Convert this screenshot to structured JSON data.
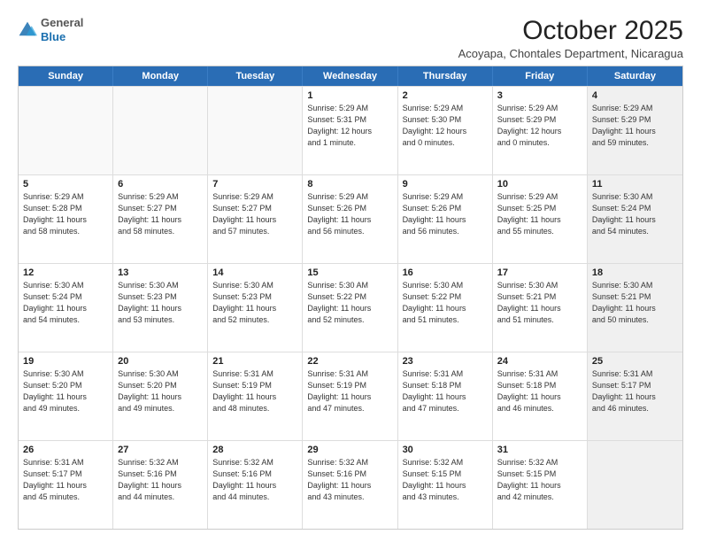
{
  "logo": {
    "general": "General",
    "blue": "Blue"
  },
  "header": {
    "month": "October 2025",
    "location": "Acoyapa, Chontales Department, Nicaragua"
  },
  "weekdays": [
    "Sunday",
    "Monday",
    "Tuesday",
    "Wednesday",
    "Thursday",
    "Friday",
    "Saturday"
  ],
  "weeks": [
    [
      {
        "day": "",
        "info": "",
        "empty": true
      },
      {
        "day": "",
        "info": "",
        "empty": true
      },
      {
        "day": "",
        "info": "",
        "empty": true
      },
      {
        "day": "1",
        "info": "Sunrise: 5:29 AM\nSunset: 5:31 PM\nDaylight: 12 hours\nand 1 minute.",
        "empty": false
      },
      {
        "day": "2",
        "info": "Sunrise: 5:29 AM\nSunset: 5:30 PM\nDaylight: 12 hours\nand 0 minutes.",
        "empty": false
      },
      {
        "day": "3",
        "info": "Sunrise: 5:29 AM\nSunset: 5:29 PM\nDaylight: 12 hours\nand 0 minutes.",
        "empty": false
      },
      {
        "day": "4",
        "info": "Sunrise: 5:29 AM\nSunset: 5:29 PM\nDaylight: 11 hours\nand 59 minutes.",
        "empty": false,
        "shaded": true
      }
    ],
    [
      {
        "day": "5",
        "info": "Sunrise: 5:29 AM\nSunset: 5:28 PM\nDaylight: 11 hours\nand 58 minutes.",
        "empty": false
      },
      {
        "day": "6",
        "info": "Sunrise: 5:29 AM\nSunset: 5:27 PM\nDaylight: 11 hours\nand 58 minutes.",
        "empty": false
      },
      {
        "day": "7",
        "info": "Sunrise: 5:29 AM\nSunset: 5:27 PM\nDaylight: 11 hours\nand 57 minutes.",
        "empty": false
      },
      {
        "day": "8",
        "info": "Sunrise: 5:29 AM\nSunset: 5:26 PM\nDaylight: 11 hours\nand 56 minutes.",
        "empty": false
      },
      {
        "day": "9",
        "info": "Sunrise: 5:29 AM\nSunset: 5:26 PM\nDaylight: 11 hours\nand 56 minutes.",
        "empty": false
      },
      {
        "day": "10",
        "info": "Sunrise: 5:29 AM\nSunset: 5:25 PM\nDaylight: 11 hours\nand 55 minutes.",
        "empty": false
      },
      {
        "day": "11",
        "info": "Sunrise: 5:30 AM\nSunset: 5:24 PM\nDaylight: 11 hours\nand 54 minutes.",
        "empty": false,
        "shaded": true
      }
    ],
    [
      {
        "day": "12",
        "info": "Sunrise: 5:30 AM\nSunset: 5:24 PM\nDaylight: 11 hours\nand 54 minutes.",
        "empty": false
      },
      {
        "day": "13",
        "info": "Sunrise: 5:30 AM\nSunset: 5:23 PM\nDaylight: 11 hours\nand 53 minutes.",
        "empty": false
      },
      {
        "day": "14",
        "info": "Sunrise: 5:30 AM\nSunset: 5:23 PM\nDaylight: 11 hours\nand 52 minutes.",
        "empty": false
      },
      {
        "day": "15",
        "info": "Sunrise: 5:30 AM\nSunset: 5:22 PM\nDaylight: 11 hours\nand 52 minutes.",
        "empty": false
      },
      {
        "day": "16",
        "info": "Sunrise: 5:30 AM\nSunset: 5:22 PM\nDaylight: 11 hours\nand 51 minutes.",
        "empty": false
      },
      {
        "day": "17",
        "info": "Sunrise: 5:30 AM\nSunset: 5:21 PM\nDaylight: 11 hours\nand 51 minutes.",
        "empty": false
      },
      {
        "day": "18",
        "info": "Sunrise: 5:30 AM\nSunset: 5:21 PM\nDaylight: 11 hours\nand 50 minutes.",
        "empty": false,
        "shaded": true
      }
    ],
    [
      {
        "day": "19",
        "info": "Sunrise: 5:30 AM\nSunset: 5:20 PM\nDaylight: 11 hours\nand 49 minutes.",
        "empty": false
      },
      {
        "day": "20",
        "info": "Sunrise: 5:30 AM\nSunset: 5:20 PM\nDaylight: 11 hours\nand 49 minutes.",
        "empty": false
      },
      {
        "day": "21",
        "info": "Sunrise: 5:31 AM\nSunset: 5:19 PM\nDaylight: 11 hours\nand 48 minutes.",
        "empty": false
      },
      {
        "day": "22",
        "info": "Sunrise: 5:31 AM\nSunset: 5:19 PM\nDaylight: 11 hours\nand 47 minutes.",
        "empty": false
      },
      {
        "day": "23",
        "info": "Sunrise: 5:31 AM\nSunset: 5:18 PM\nDaylight: 11 hours\nand 47 minutes.",
        "empty": false
      },
      {
        "day": "24",
        "info": "Sunrise: 5:31 AM\nSunset: 5:18 PM\nDaylight: 11 hours\nand 46 minutes.",
        "empty": false
      },
      {
        "day": "25",
        "info": "Sunrise: 5:31 AM\nSunset: 5:17 PM\nDaylight: 11 hours\nand 46 minutes.",
        "empty": false,
        "shaded": true
      }
    ],
    [
      {
        "day": "26",
        "info": "Sunrise: 5:31 AM\nSunset: 5:17 PM\nDaylight: 11 hours\nand 45 minutes.",
        "empty": false
      },
      {
        "day": "27",
        "info": "Sunrise: 5:32 AM\nSunset: 5:16 PM\nDaylight: 11 hours\nand 44 minutes.",
        "empty": false
      },
      {
        "day": "28",
        "info": "Sunrise: 5:32 AM\nSunset: 5:16 PM\nDaylight: 11 hours\nand 44 minutes.",
        "empty": false
      },
      {
        "day": "29",
        "info": "Sunrise: 5:32 AM\nSunset: 5:16 PM\nDaylight: 11 hours\nand 43 minutes.",
        "empty": false
      },
      {
        "day": "30",
        "info": "Sunrise: 5:32 AM\nSunset: 5:15 PM\nDaylight: 11 hours\nand 43 minutes.",
        "empty": false
      },
      {
        "day": "31",
        "info": "Sunrise: 5:32 AM\nSunset: 5:15 PM\nDaylight: 11 hours\nand 42 minutes.",
        "empty": false
      },
      {
        "day": "",
        "info": "",
        "empty": true,
        "shaded": true
      }
    ]
  ]
}
